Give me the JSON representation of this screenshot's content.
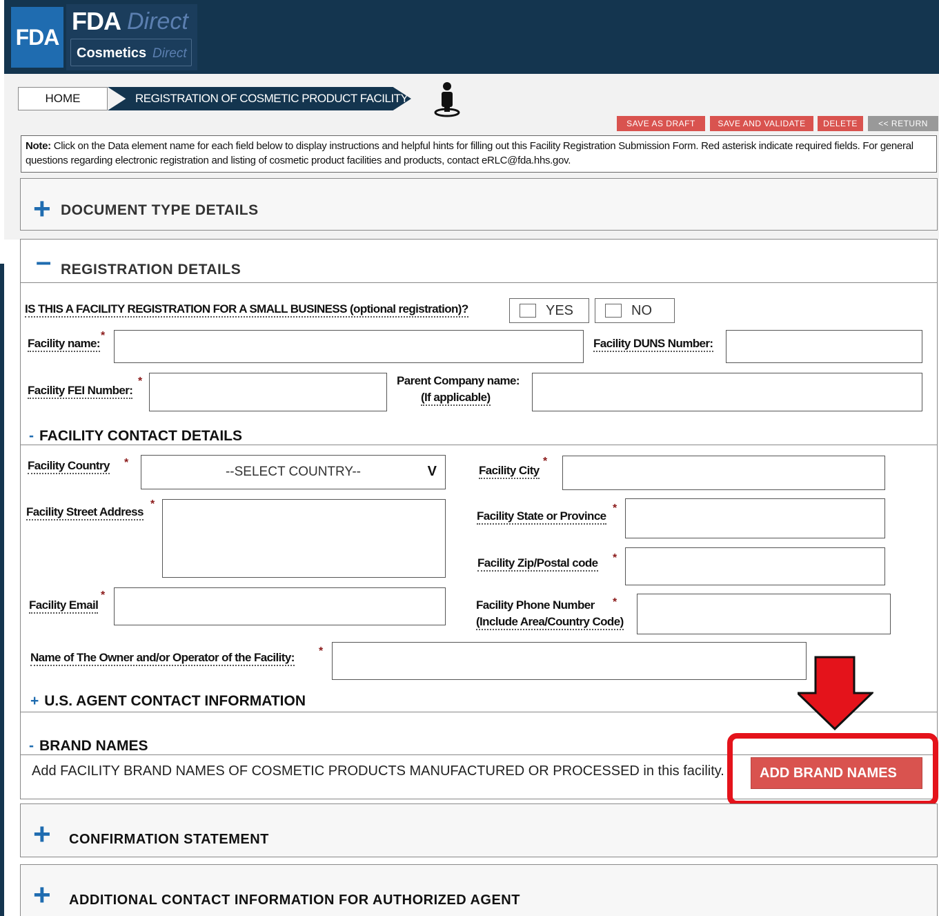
{
  "header": {
    "fda_badge": "FDA",
    "product_fda": "FDA",
    "product_direct": "Direct",
    "product_sub": "Cosmetics",
    "product_sub_direct": "Direct"
  },
  "breadcrumb": {
    "home": "HOME",
    "current": "REGISTRATION OF COSMETIC PRODUCT FACILITY"
  },
  "actions": {
    "save_draft": "SAVE AS DRAFT",
    "save_validate": "SAVE AND VALIDATE",
    "delete": "DELETE",
    "return": "<< RETURN"
  },
  "note": {
    "bold": "Note:",
    "text": " Click on the Data element name for each field below to display instructions and helpful hints for filling out this Facility Registration Submission Form. Red asterisk indicate required fields. For general questions regarding electronic registration and listing of cosmetic product facilities and products, contact eRLC@fda.hhs.gov."
  },
  "sections": {
    "document_type": "DOCUMENT TYPE DETAILS",
    "registration": "REGISTRATION DETAILS",
    "confirmation": "CONFIRMATION STATEMENT",
    "additional": "ADDITIONAL CONTACT INFORMATION FOR AUTHORIZED AGENT"
  },
  "registration": {
    "small_business_q": "IS THIS A FACILITY REGISTRATION FOR A SMALL BUSINESS (optional registration)?",
    "yes": "YES",
    "no": "NO",
    "facility_name": "Facility name:",
    "duns": "Facility DUNS Number:",
    "fei": "Facility FEI Number:",
    "parent_line1": "Parent Company name:",
    "parent_line2": "(If applicable)"
  },
  "contact": {
    "header": "FACILITY CONTACT DETAILS",
    "country": "Facility Country",
    "country_select": "--SELECT COUNTRY--",
    "city": "Facility City",
    "street": "Facility Street Address",
    "state": "Facility State or Province",
    "zip": "Facility Zip/Postal code",
    "email": "Facility Email",
    "phone_line1": "Facility Phone Number",
    "phone_line2": "(Include Area/Country Code)",
    "owner": "Name of The Owner and/or Operator of the Facility:"
  },
  "us_agent": {
    "header": "U.S. AGENT CONTACT INFORMATION"
  },
  "brand": {
    "header": "BRAND NAMES",
    "text": "Add FACILITY BRAND NAMES OF COSMETIC PRODUCTS MANUFACTURED OR PROCESSED in this facility.",
    "button": "ADD BRAND NAMES"
  },
  "symbols": {
    "plus": "+",
    "minus": "-",
    "asterisk": "*",
    "caret": "V"
  },
  "colors": {
    "header_bg": "#14354f",
    "accent_blue": "#1f6cb0",
    "action_red": "#d9534f",
    "highlight_red": "#e4131b",
    "return_gray": "#999999"
  }
}
